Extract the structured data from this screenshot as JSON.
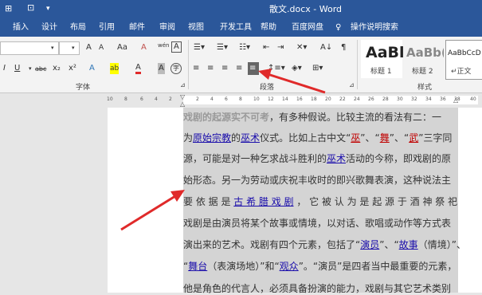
{
  "window": {
    "title": "散文.docx - Word",
    "qat_icons": [
      "touch-mode-icon",
      "print-preview-icon",
      "customize-qat-icon"
    ]
  },
  "menu": {
    "tabs": [
      "插入",
      "设计",
      "布局",
      "引用",
      "邮件",
      "审阅",
      "视图",
      "开发工具",
      "帮助",
      "百度网盘"
    ],
    "tell_me": "操作说明搜索"
  },
  "ribbon": {
    "font_group_label": "字体",
    "paragraph_group_label": "段落",
    "styles_group_label": "样式",
    "font_buttons": {
      "grow": "A",
      "shrink": "A",
      "case": "Aa",
      "clear": "A",
      "phonetic": "wén",
      "border": "A",
      "italic": "I",
      "underline": "U",
      "strike": "abc",
      "subscript": "x₂",
      "superscript": "x²",
      "effects": "A",
      "highlight": "ab",
      "font_color": "A",
      "shading": "A",
      "enclose": "字"
    },
    "styles": [
      {
        "preview": "AaBl",
        "name": "标题 1"
      },
      {
        "preview": "AaBb(",
        "name": "标题 2"
      },
      {
        "preview": "AaBbCcD",
        "name": "↵正文"
      }
    ]
  },
  "ruler": {
    "left_ticks": [
      "10",
      "8",
      "6",
      "4",
      "2"
    ],
    "right_ticks": [
      "2",
      "4",
      "6",
      "8",
      "10",
      "12",
      "14",
      "16",
      "18",
      "20",
      "22",
      "24",
      "26",
      "28",
      "30",
      "32",
      "34",
      "36",
      "38",
      "40"
    ]
  },
  "document": {
    "line1": {
      "title": "戏剧的起源实不可考",
      "text": "，有多种假说。比较主流的看法有二：一"
    },
    "line2": {
      "a": "为",
      "l1": "原始宗教",
      "b": "的",
      "l2": "巫术",
      "c": "仪式。比如上古中文“",
      "r1": "巫",
      "d": "”、“",
      "r2": "舞",
      "e": "”、“",
      "r3": "武",
      "f": "”三字同"
    },
    "line3": {
      "a": "源，可能是对一种乞求战斗胜利的",
      "l1": "巫术",
      "b": "活动的今称，即戏剧的原"
    },
    "line4": {
      "text": "始形态。另一为劳动或庆祝丰收时的即兴歌舞表演，这种说法主"
    },
    "line5": {
      "a": "要 依 据 是 ",
      "l1": "古 希 腊 戏 剧",
      "b": " ， 它 被 认 为 是 起 源 于 酒 神 祭 祀"
    },
    "line6": {
      "text": "戏剧是由演员将某个故事或情境，以对话、歌唱或动作等方式表"
    },
    "line7": {
      "a": "演出来的艺术。戏剧有四个元素，包括了“",
      "l1": "演员",
      "b": "”、“",
      "l2": "故事",
      "c": "（情境）”、"
    },
    "line8": {
      "a": "“",
      "l1": "舞台",
      "b": "（表演场地）”和“",
      "l2": "观众",
      "c": "”。“演员”是四者当中最重要的元素，"
    },
    "line9": {
      "text": "他是角色的代言人，必须具备扮演的能力，戏剧与其它艺术类别"
    }
  },
  "colors": {
    "title_bar": "#2b579a",
    "ribbon": "#f3f3f3",
    "selection": "#d4d4d4",
    "link": "#1a0dab",
    "arrow": "#e02a2a",
    "red_text": "#c00000"
  }
}
